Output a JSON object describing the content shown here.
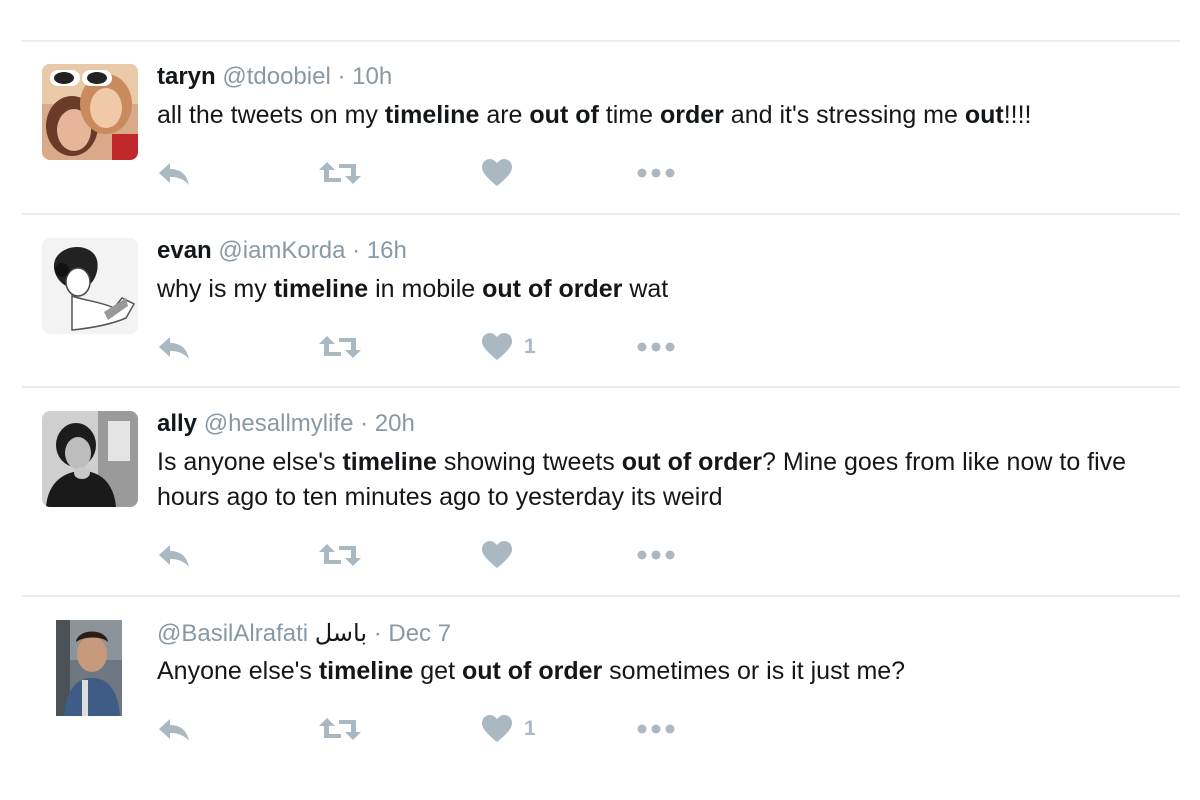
{
  "tweets": [
    {
      "name": "taryn",
      "handle": "@tdoobiel",
      "separator": " · ",
      "time": "10h",
      "body": [
        {
          "t": "all the tweets on my ",
          "b": false
        },
        {
          "t": "timeline",
          "b": true
        },
        {
          "t": " are ",
          "b": false
        },
        {
          "t": "out of",
          "b": true
        },
        {
          "t": " time ",
          "b": false
        },
        {
          "t": "order",
          "b": true
        },
        {
          "t": " and it's stressing me ",
          "b": false
        },
        {
          "t": "out",
          "b": true
        },
        {
          "t": "!!!!",
          "b": false
        }
      ],
      "like_count": ""
    },
    {
      "name": "evan",
      "handle": "@iamKorda",
      "separator": " · ",
      "time": "16h",
      "body": [
        {
          "t": "why is my ",
          "b": false
        },
        {
          "t": "timeline",
          "b": true
        },
        {
          "t": " in mobile ",
          "b": false
        },
        {
          "t": "out of order",
          "b": true
        },
        {
          "t": " wat",
          "b": false
        }
      ],
      "like_count": "1"
    },
    {
      "name": "ally",
      "handle": "@hesallmylife",
      "separator": " · ",
      "time": "20h",
      "body": [
        {
          "t": "Is anyone else's ",
          "b": false
        },
        {
          "t": "timeline",
          "b": true
        },
        {
          "t": " showing tweets ",
          "b": false
        },
        {
          "t": "out of order",
          "b": true
        },
        {
          "t": "? Mine goes from like now to five hours ago to ten minutes ago to yesterday its weird",
          "b": false
        }
      ],
      "like_count": ""
    },
    {
      "name": "",
      "handle": "@BasilAlrafati",
      "rtl_name": "باسل",
      "separator": " · ",
      "time": "Dec 7",
      "body": [
        {
          "t": "Anyone else's ",
          "b": false
        },
        {
          "t": "timeline",
          "b": true
        },
        {
          "t": " get ",
          "b": false
        },
        {
          "t": "out of order",
          "b": true
        },
        {
          "t": " sometimes or is it just me?",
          "b": false
        }
      ],
      "like_count": "1"
    }
  ],
  "icons": {
    "reply": "reply-icon",
    "retweet": "retweet-icon",
    "like": "heart-icon",
    "more": "more-icon"
  },
  "colors": {
    "icon": "#aab8c2",
    "divider": "#e6ecf0",
    "meta": "#8899a6",
    "text": "#14171a"
  }
}
